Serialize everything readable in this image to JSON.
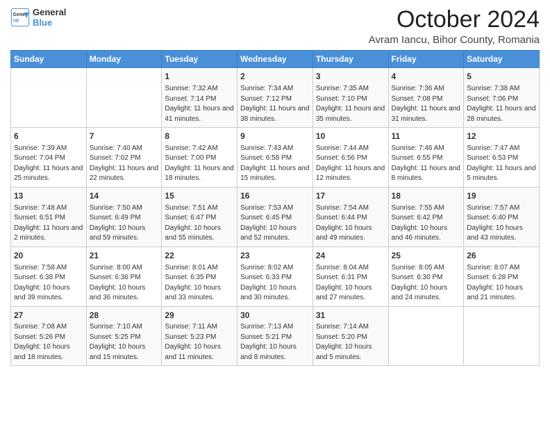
{
  "logo": {
    "line1": "General",
    "line2": "Blue"
  },
  "title": "October 2024",
  "subtitle": "Avram Iancu, Bihor County, Romania",
  "days_of_week": [
    "Sunday",
    "Monday",
    "Tuesday",
    "Wednesday",
    "Thursday",
    "Friday",
    "Saturday"
  ],
  "weeks": [
    [
      {
        "day": "",
        "content": ""
      },
      {
        "day": "",
        "content": ""
      },
      {
        "day": "1",
        "content": "Sunrise: 7:32 AM\nSunset: 7:14 PM\nDaylight: 11 hours and 41 minutes."
      },
      {
        "day": "2",
        "content": "Sunrise: 7:34 AM\nSunset: 7:12 PM\nDaylight: 11 hours and 38 minutes."
      },
      {
        "day": "3",
        "content": "Sunrise: 7:35 AM\nSunset: 7:10 PM\nDaylight: 11 hours and 35 minutes."
      },
      {
        "day": "4",
        "content": "Sunrise: 7:36 AM\nSunset: 7:08 PM\nDaylight: 11 hours and 31 minutes."
      },
      {
        "day": "5",
        "content": "Sunrise: 7:38 AM\nSunset: 7:06 PM\nDaylight: 11 hours and 28 minutes."
      }
    ],
    [
      {
        "day": "6",
        "content": "Sunrise: 7:39 AM\nSunset: 7:04 PM\nDaylight: 11 hours and 25 minutes."
      },
      {
        "day": "7",
        "content": "Sunrise: 7:40 AM\nSunset: 7:02 PM\nDaylight: 11 hours and 22 minutes."
      },
      {
        "day": "8",
        "content": "Sunrise: 7:42 AM\nSunset: 7:00 PM\nDaylight: 11 hours and 18 minutes."
      },
      {
        "day": "9",
        "content": "Sunrise: 7:43 AM\nSunset: 6:58 PM\nDaylight: 11 hours and 15 minutes."
      },
      {
        "day": "10",
        "content": "Sunrise: 7:44 AM\nSunset: 6:56 PM\nDaylight: 11 hours and 12 minutes."
      },
      {
        "day": "11",
        "content": "Sunrise: 7:46 AM\nSunset: 6:55 PM\nDaylight: 11 hours and 8 minutes."
      },
      {
        "day": "12",
        "content": "Sunrise: 7:47 AM\nSunset: 6:53 PM\nDaylight: 11 hours and 5 minutes."
      }
    ],
    [
      {
        "day": "13",
        "content": "Sunrise: 7:48 AM\nSunset: 6:51 PM\nDaylight: 11 hours and 2 minutes."
      },
      {
        "day": "14",
        "content": "Sunrise: 7:50 AM\nSunset: 6:49 PM\nDaylight: 10 hours and 59 minutes."
      },
      {
        "day": "15",
        "content": "Sunrise: 7:51 AM\nSunset: 6:47 PM\nDaylight: 10 hours and 55 minutes."
      },
      {
        "day": "16",
        "content": "Sunrise: 7:53 AM\nSunset: 6:45 PM\nDaylight: 10 hours and 52 minutes."
      },
      {
        "day": "17",
        "content": "Sunrise: 7:54 AM\nSunset: 6:44 PM\nDaylight: 10 hours and 49 minutes."
      },
      {
        "day": "18",
        "content": "Sunrise: 7:55 AM\nSunset: 6:42 PM\nDaylight: 10 hours and 46 minutes."
      },
      {
        "day": "19",
        "content": "Sunrise: 7:57 AM\nSunset: 6:40 PM\nDaylight: 10 hours and 43 minutes."
      }
    ],
    [
      {
        "day": "20",
        "content": "Sunrise: 7:58 AM\nSunset: 6:38 PM\nDaylight: 10 hours and 39 minutes."
      },
      {
        "day": "21",
        "content": "Sunrise: 8:00 AM\nSunset: 6:36 PM\nDaylight: 10 hours and 36 minutes."
      },
      {
        "day": "22",
        "content": "Sunrise: 8:01 AM\nSunset: 6:35 PM\nDaylight: 10 hours and 33 minutes."
      },
      {
        "day": "23",
        "content": "Sunrise: 8:02 AM\nSunset: 6:33 PM\nDaylight: 10 hours and 30 minutes."
      },
      {
        "day": "24",
        "content": "Sunrise: 8:04 AM\nSunset: 6:31 PM\nDaylight: 10 hours and 27 minutes."
      },
      {
        "day": "25",
        "content": "Sunrise: 8:05 AM\nSunset: 6:30 PM\nDaylight: 10 hours and 24 minutes."
      },
      {
        "day": "26",
        "content": "Sunrise: 8:07 AM\nSunset: 6:28 PM\nDaylight: 10 hours and 21 minutes."
      }
    ],
    [
      {
        "day": "27",
        "content": "Sunrise: 7:08 AM\nSunset: 5:26 PM\nDaylight: 10 hours and 18 minutes."
      },
      {
        "day": "28",
        "content": "Sunrise: 7:10 AM\nSunset: 5:25 PM\nDaylight: 10 hours and 15 minutes."
      },
      {
        "day": "29",
        "content": "Sunrise: 7:11 AM\nSunset: 5:23 PM\nDaylight: 10 hours and 11 minutes."
      },
      {
        "day": "30",
        "content": "Sunrise: 7:13 AM\nSunset: 5:21 PM\nDaylight: 10 hours and 8 minutes."
      },
      {
        "day": "31",
        "content": "Sunrise: 7:14 AM\nSunset: 5:20 PM\nDaylight: 10 hours and 5 minutes."
      },
      {
        "day": "",
        "content": ""
      },
      {
        "day": "",
        "content": ""
      }
    ]
  ]
}
